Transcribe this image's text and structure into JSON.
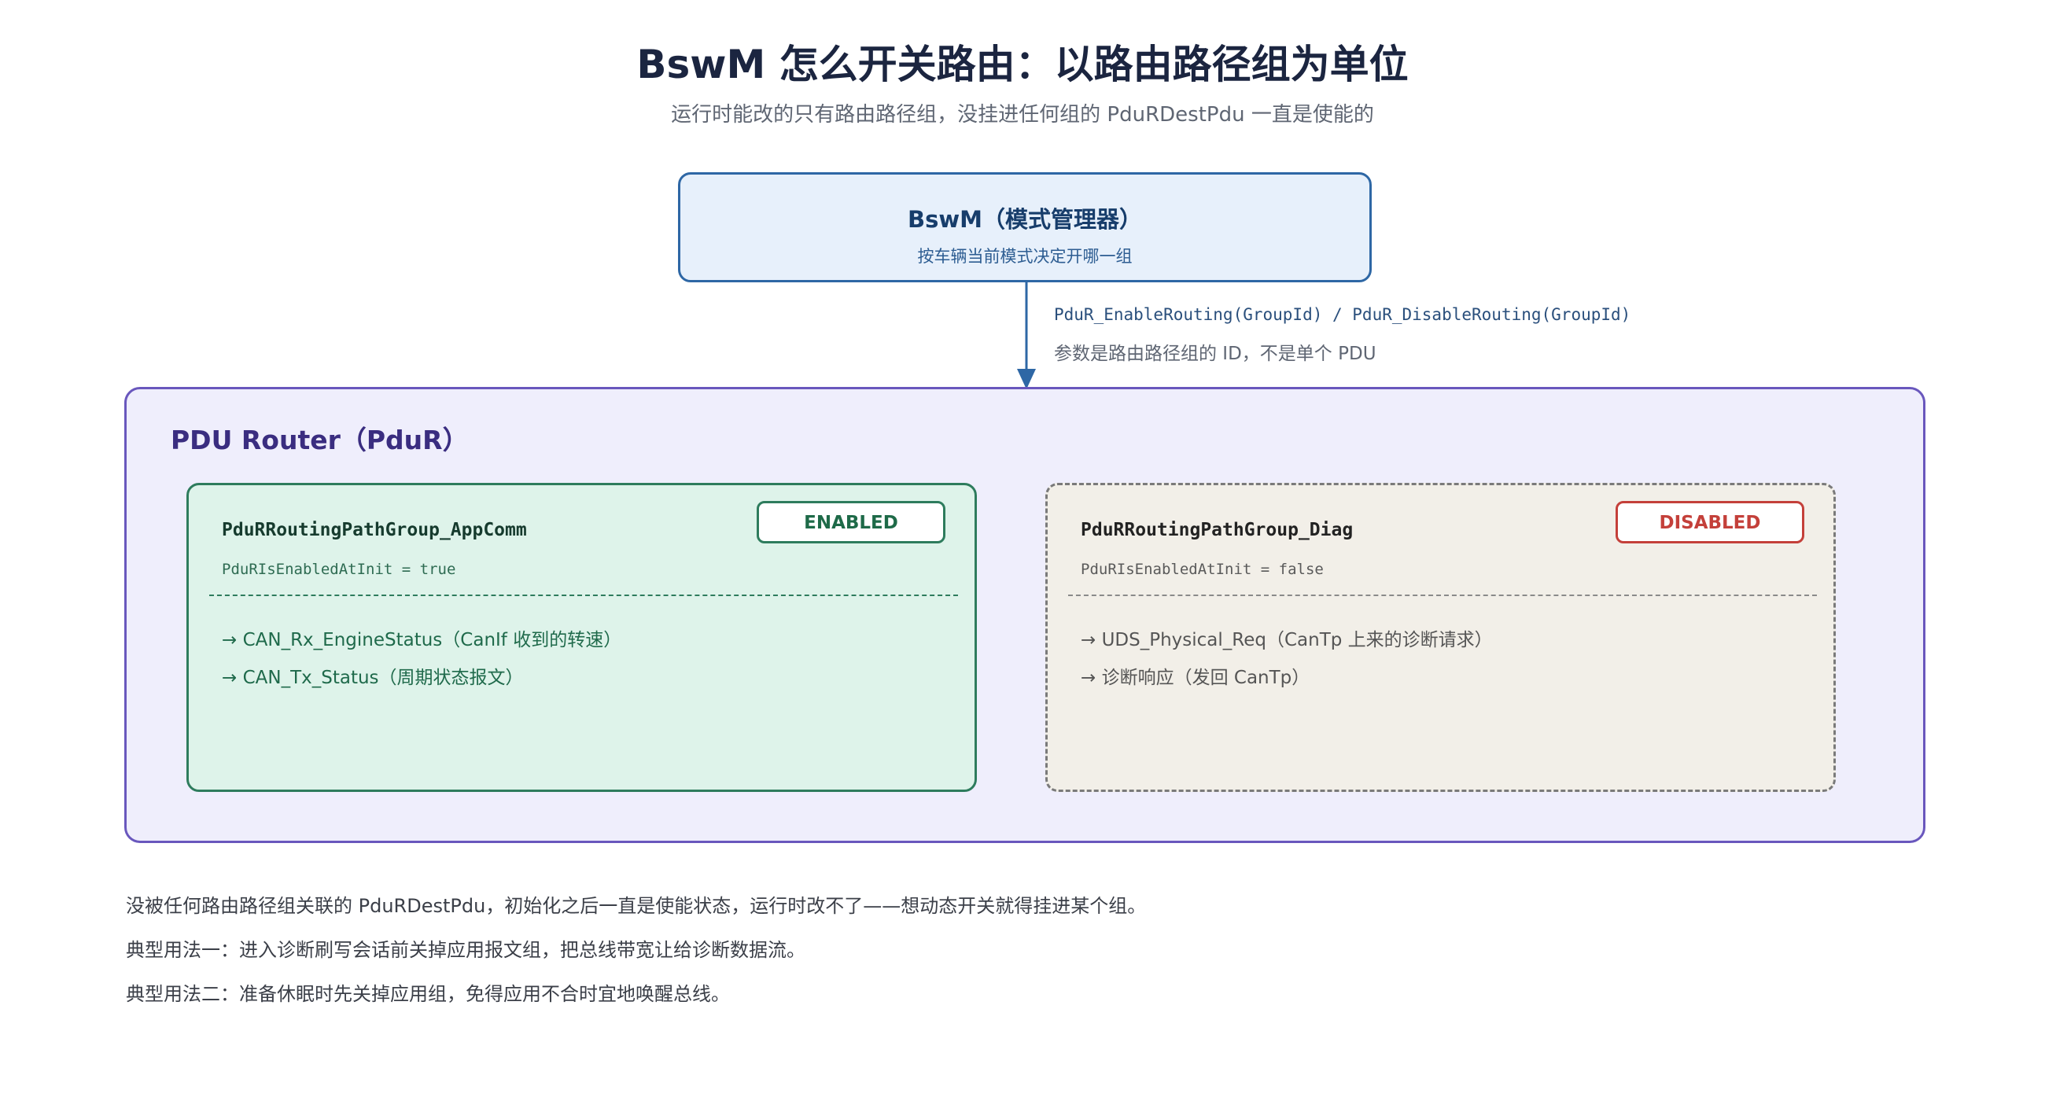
{
  "header": {
    "title": "BswM 怎么开关路由：以路由路径组为单位",
    "subtitle": "运行时能改的只有路由路径组，没挂进任何组的 PduRDestPdu 一直是使能的"
  },
  "bswm": {
    "title": "BswM（模式管理器）",
    "description": "按车辆当前模式决定开哪一组"
  },
  "connector": {
    "call": "PduR_EnableRouting(GroupId) / PduR_DisableRouting(GroupId)",
    "note": "参数是路由路径组的 ID，不是单个 PDU"
  },
  "pdur": {
    "title": "PDU Router（PduR）",
    "groups": [
      {
        "name": "PduRRoutingPathGroup_AppComm",
        "init": "PduRIsEnabledAtInit = true",
        "status": "ENABLED",
        "routes": [
          "→ CAN_Rx_EngineStatus（CanIf 收到的转速）",
          "→ CAN_Tx_Status（周期状态报文）"
        ]
      },
      {
        "name": "PduRRoutingPathGroup_Diag",
        "init": "PduRIsEnabledAtInit = false",
        "status": "DISABLED",
        "routes": [
          "→ UDS_Physical_Req（CanTp 上来的诊断请求）",
          "→ 诊断响应（发回 CanTp）"
        ]
      }
    ]
  },
  "notes": [
    "没被任何路由路径组关联的 PduRDestPdu，初始化之后一直是使能状态，运行时改不了——想动态开关就得挂进某个组。",
    "典型用法一：进入诊断刷写会话前关掉应用报文组，把总线带宽让给诊断数据流。",
    "典型用法二：准备休眠时先关掉应用组，免得应用不合时宜地唤醒总线。"
  ],
  "colors": {
    "bswm_border": "#2e67a5",
    "bswm_fill": "#e7f0fb",
    "pdur_border": "#6957bd",
    "pdur_fill": "#efeefc",
    "enabled_border": "#2e7c5d",
    "enabled_fill": "#def3ea",
    "disabled_border": "#7a7a7a",
    "disabled_fill": "#f2efe8",
    "disabled_badge": "#c4403a",
    "arrow": "#2e67a5"
  }
}
